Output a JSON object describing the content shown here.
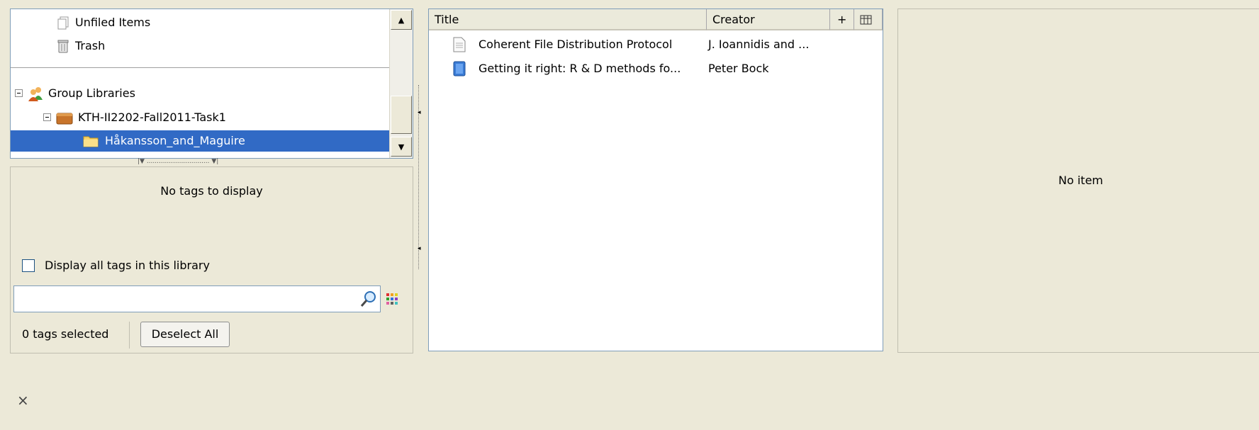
{
  "collections": {
    "unfiled_label": "Unfiled Items",
    "trash_label": "Trash",
    "group_libraries_label": "Group Libraries",
    "library_label": "KTH-II2202-Fall2011-Task1",
    "selected_collection_label": "Håkansson_and_Maguire"
  },
  "tags": {
    "empty_message": "No tags to display",
    "display_all_label": "Display all tags in this library",
    "search_value": "",
    "selected_count": "0 tags selected",
    "deselect_all_label": "Deselect All"
  },
  "items": {
    "columns": [
      "Title",
      "Creator",
      "+"
    ],
    "rows": [
      {
        "title": "Coherent File Distribution Protocol",
        "creator": "J. Ioannidis and ...",
        "icon": "document-icon"
      },
      {
        "title": "Getting it right: R & D methods fo...",
        "creator": "Peter Bock",
        "icon": "book-icon"
      }
    ]
  },
  "item_pane": {
    "message": "No item"
  },
  "footer": {
    "close_glyph": "×"
  },
  "colors": {
    "selection": "#316ac5",
    "background": "#ece9d8",
    "border": "#7f9db9"
  }
}
